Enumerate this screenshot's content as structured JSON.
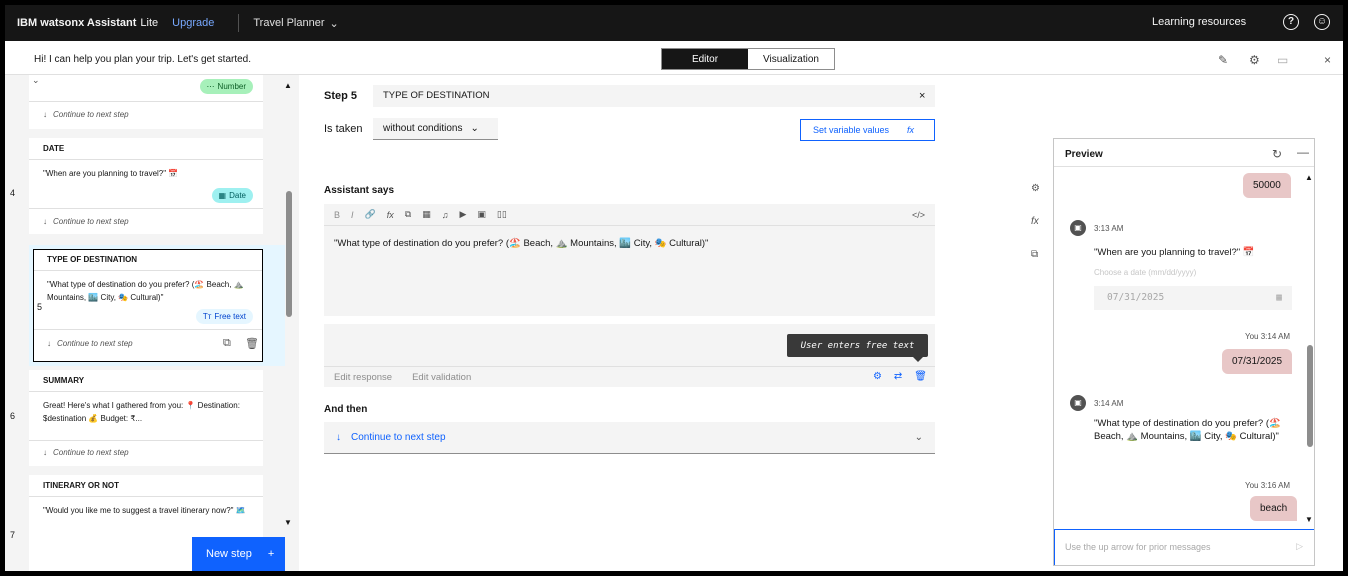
{
  "topbar": {
    "brand": "IBM watsonx Assistant",
    "plan": "Lite",
    "upgrade": "Upgrade",
    "assistant_name": "Travel Planner",
    "learning": "Learning resources"
  },
  "subbar": {
    "greeting": "Hi! I can help you plan your trip. Let's get started.",
    "tabs": [
      "Editor",
      "Visualization"
    ],
    "active_tab": "Editor"
  },
  "steps_panel": {
    "steps": [
      {
        "tag": "Number",
        "continue": "Continue to next step"
      },
      {
        "num": "4",
        "title": "DATE",
        "body": "\"When are you planning to travel?\" 📅",
        "tag": "Date",
        "continue": "Continue to next step"
      },
      {
        "num": "5",
        "title": "TYPE OF DESTINATION",
        "body": "\"What type of destination do you prefer? (🏖️ Beach, ⛰️ Mountains, 🏙️ City, 🎭 Cultural)\"",
        "tag": "Free text",
        "continue": "Continue to next step"
      },
      {
        "num": "6",
        "title": "SUMMARY",
        "body": "Great! Here's what I gathered from you: 📍 Destination: $destination 💰 Budget: ₹...",
        "continue": "Continue to next step"
      },
      {
        "num": "7",
        "title": "ITINERARY OR NOT",
        "body": "\"Would you like me to suggest a travel itinerary now?\" 🗺️"
      }
    ],
    "new_step": "New step",
    "new_step_icon": "+"
  },
  "editor": {
    "step_label": "Step 5",
    "step_title": "TYPE OF DESTINATION",
    "is_taken_label": "Is taken",
    "condition": "without conditions",
    "set_variable": "Set variable values",
    "set_variable_icon": "fx",
    "assistant_says": "Assistant says",
    "toolbar": [
      "B",
      "I",
      "🔗",
      "fx",
      "⧉",
      "▦",
      "♫",
      "▶",
      "▣",
      "▯▯"
    ],
    "toolbar_code": "</>",
    "message": "\"What type of destination do you prefer? (🏖️ Beach, ⛰️ Mountains, 🏙️ City, 🎭 Cultural)\"",
    "tooltip": "User enters free text",
    "resp_tabs": [
      "Edit response",
      "Edit validation"
    ],
    "and_then": "And then",
    "continue": "Continue to next step"
  },
  "preview": {
    "title": "Preview",
    "messages": {
      "user1": "50000",
      "bot1_time": "3:13 AM",
      "bot1_text": "\"When are you planning to travel?\" 📅",
      "date_hint": "Choose a date (mm/dd/yyyy)",
      "date_value": "07/31/2025",
      "user2_time": "You 3:14 AM",
      "user2": "07/31/2025",
      "bot2_time": "3:14 AM",
      "bot2_text": "\"What type of destination do you prefer? (🏖️ Beach, ⛰️ Mountains, 🏙️ City, 🎭 Cultural)\"",
      "user3_time": "You 3:16 AM",
      "user3": "beach"
    },
    "input_placeholder": "Use the up arrow for prior messages"
  },
  "colors": {
    "accent": "#0f62fe",
    "user_bubble": "#e8c7c7",
    "topbar": "#161616"
  }
}
